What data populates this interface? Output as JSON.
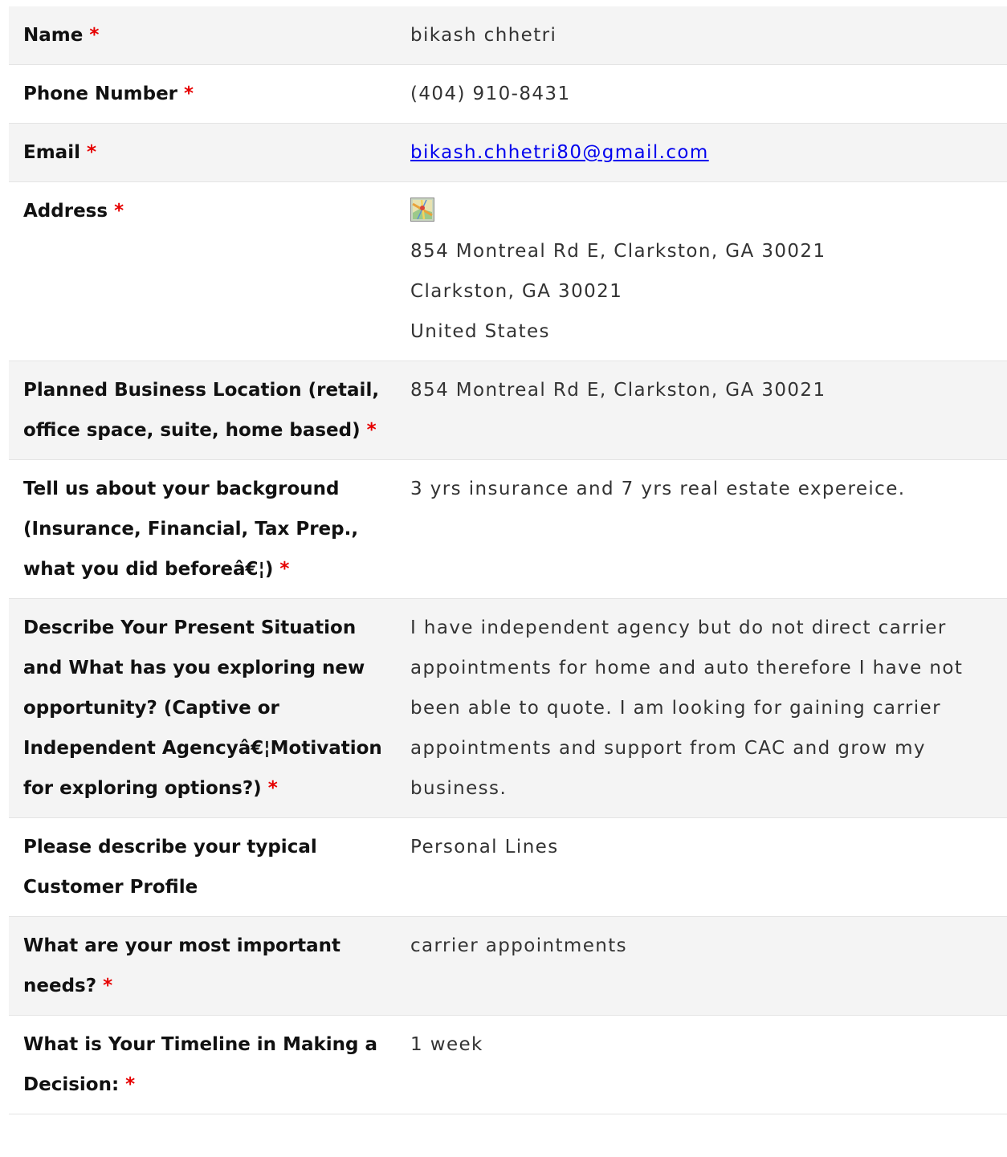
{
  "required_marker": "*",
  "colors": {
    "required": "#e60000",
    "link": "#0000ee",
    "row_shade": "#f4f4f4"
  },
  "fields": {
    "name": {
      "label": "Name",
      "value": "bikash chhetri"
    },
    "phone": {
      "label": "Phone Number",
      "value": "(404) 910-8431"
    },
    "email": {
      "label": "Email",
      "value": "bikash.chhetri80@gmail.com"
    },
    "address": {
      "label": "Address",
      "icon": "map-icon",
      "line1": "854 Montreal Rd E, Clarkston, GA 30021",
      "line2": "Clarkston, GA 30021",
      "line3": "United States"
    },
    "business_location": {
      "label": "Planned Business Location (retail, office space, suite, home based)",
      "value": "854 Montreal Rd E, Clarkston, GA 30021"
    },
    "background": {
      "label": "Tell us about your background (Insurance, Financial, Tax Prep., what you did beforeâ€¦)",
      "value": "3 yrs insurance and 7 yrs real estate expereice."
    },
    "situation": {
      "label": "Describe Your Present Situation and What has you exploring new opportunity? (Captive or Independent Agencyâ€¦Motivation for exploring options?)",
      "value": "I have independent agency but do not direct carrier appointments for home and auto therefore I have not been able to quote. I am looking for gaining carrier appointments and support from CAC and grow my business."
    },
    "customer_profile": {
      "label": "Please describe your typical Customer Profile",
      "value": "Personal Lines"
    },
    "needs": {
      "label": "What are your most important needs?",
      "value": "carrier appointments"
    },
    "timeline": {
      "label": "What is Your Timeline in Making a Decision:",
      "value": "1 week"
    }
  }
}
